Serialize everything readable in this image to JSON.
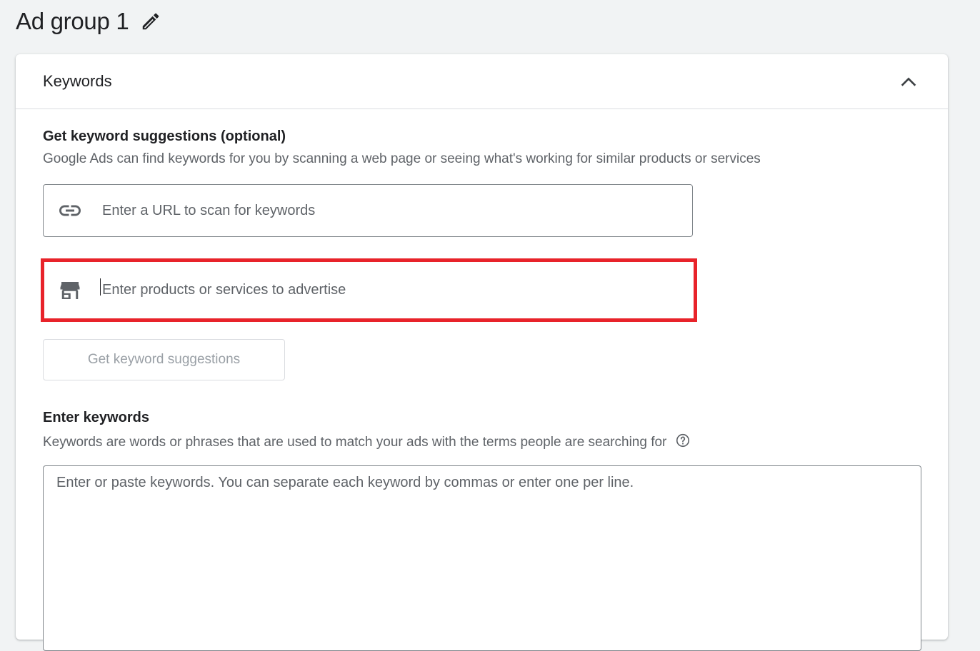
{
  "page": {
    "title": "Ad group 1",
    "edit_icon": "pencil-icon"
  },
  "keywords_panel": {
    "title": "Keywords",
    "collapse_icon": "chevron-up-icon",
    "suggestions": {
      "title": "Get keyword suggestions (optional)",
      "description": "Google Ads can find keywords for you by scanning a web page or seeing what's working for similar products or services",
      "url_input": {
        "icon": "link-icon",
        "placeholder": "Enter a URL to scan for keywords",
        "value": ""
      },
      "products_input": {
        "icon": "store-icon",
        "placeholder": "Enter products or services to advertise",
        "value": "",
        "focused": true
      },
      "button_label": "Get keyword suggestions",
      "button_disabled": true
    },
    "enter_keywords": {
      "title": "Enter keywords",
      "description": "Keywords are words or phrases that are used to match your ads with the terms people are searching for",
      "help_icon": "help-circle-icon",
      "textarea_placeholder": "Enter or paste keywords. You can separate each keyword by commas or enter one per line."
    }
  },
  "colors": {
    "page_background": "#f1f3f4",
    "highlight_border": "#e8232a",
    "disabled_text": "#9aa0a6",
    "secondary_text": "#5f6368"
  }
}
